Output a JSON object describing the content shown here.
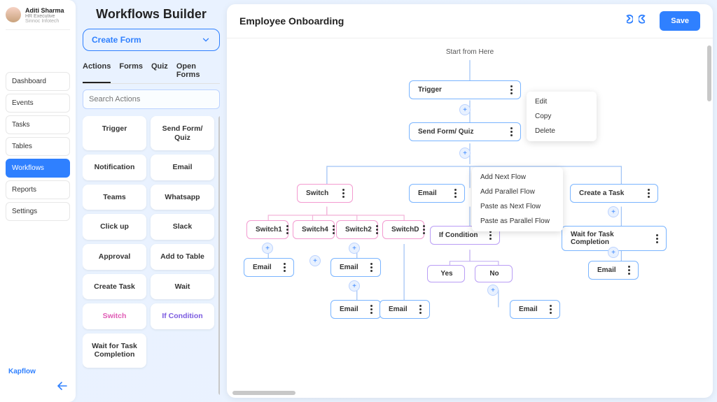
{
  "user": {
    "name": "Aditi Sharma",
    "title": "HR Executive",
    "org": "Sinnoc Infotech"
  },
  "sidebar": {
    "items": [
      {
        "label": "Dashboard"
      },
      {
        "label": "Events"
      },
      {
        "label": "Tasks"
      },
      {
        "label": "Tables"
      },
      {
        "label": "Workflows"
      },
      {
        "label": "Reports"
      },
      {
        "label": "Settings"
      }
    ],
    "active_index": 4,
    "brand": "Kapflow"
  },
  "builder": {
    "title": "Workflows Builder",
    "create_form_label": "Create Form",
    "tabs": [
      {
        "label": "Actions"
      },
      {
        "label": "Forms"
      },
      {
        "label": "Quiz"
      },
      {
        "label": "Open Forms"
      }
    ],
    "active_tab": 0,
    "search_placeholder": "Search Actions",
    "actions": [
      "Trigger",
      "Send Form/ Quiz",
      "Notification",
      "Email",
      "Teams",
      "Whatsapp",
      "Click up",
      "Slack",
      "Approval",
      "Add to Table",
      "Create Task",
      "Wait",
      "Switch",
      "If Condition",
      "Wait for Task Completion"
    ]
  },
  "canvas": {
    "title": "Employee Onboarding",
    "save_label": "Save",
    "start_label": "Start from Here",
    "node_menu": [
      "Edit",
      "Copy",
      "Delete"
    ],
    "flow_menu": [
      "Add Next Flow",
      "Add Parallel Flow",
      "Paste as Next Flow",
      "Paste as Parallel Flow"
    ],
    "nodes": {
      "trigger": "Trigger",
      "sendform": "Send Form/ Quiz",
      "switch": "Switch",
      "switch1": "Switch1",
      "switch4": "Switch4",
      "switch2": "Switch2",
      "switchd": "SwitchD",
      "email_sw1": "Email",
      "email_sw2": "Email",
      "email_sw2b": "Email",
      "email_swd": "Email",
      "email_right": "Email",
      "if": "If Condition",
      "yes": "Yes",
      "no": "No",
      "email_no": "Email",
      "create_task": "Create a Task",
      "wait_task": "Wait for Task Completion",
      "email_task": "Email"
    }
  }
}
